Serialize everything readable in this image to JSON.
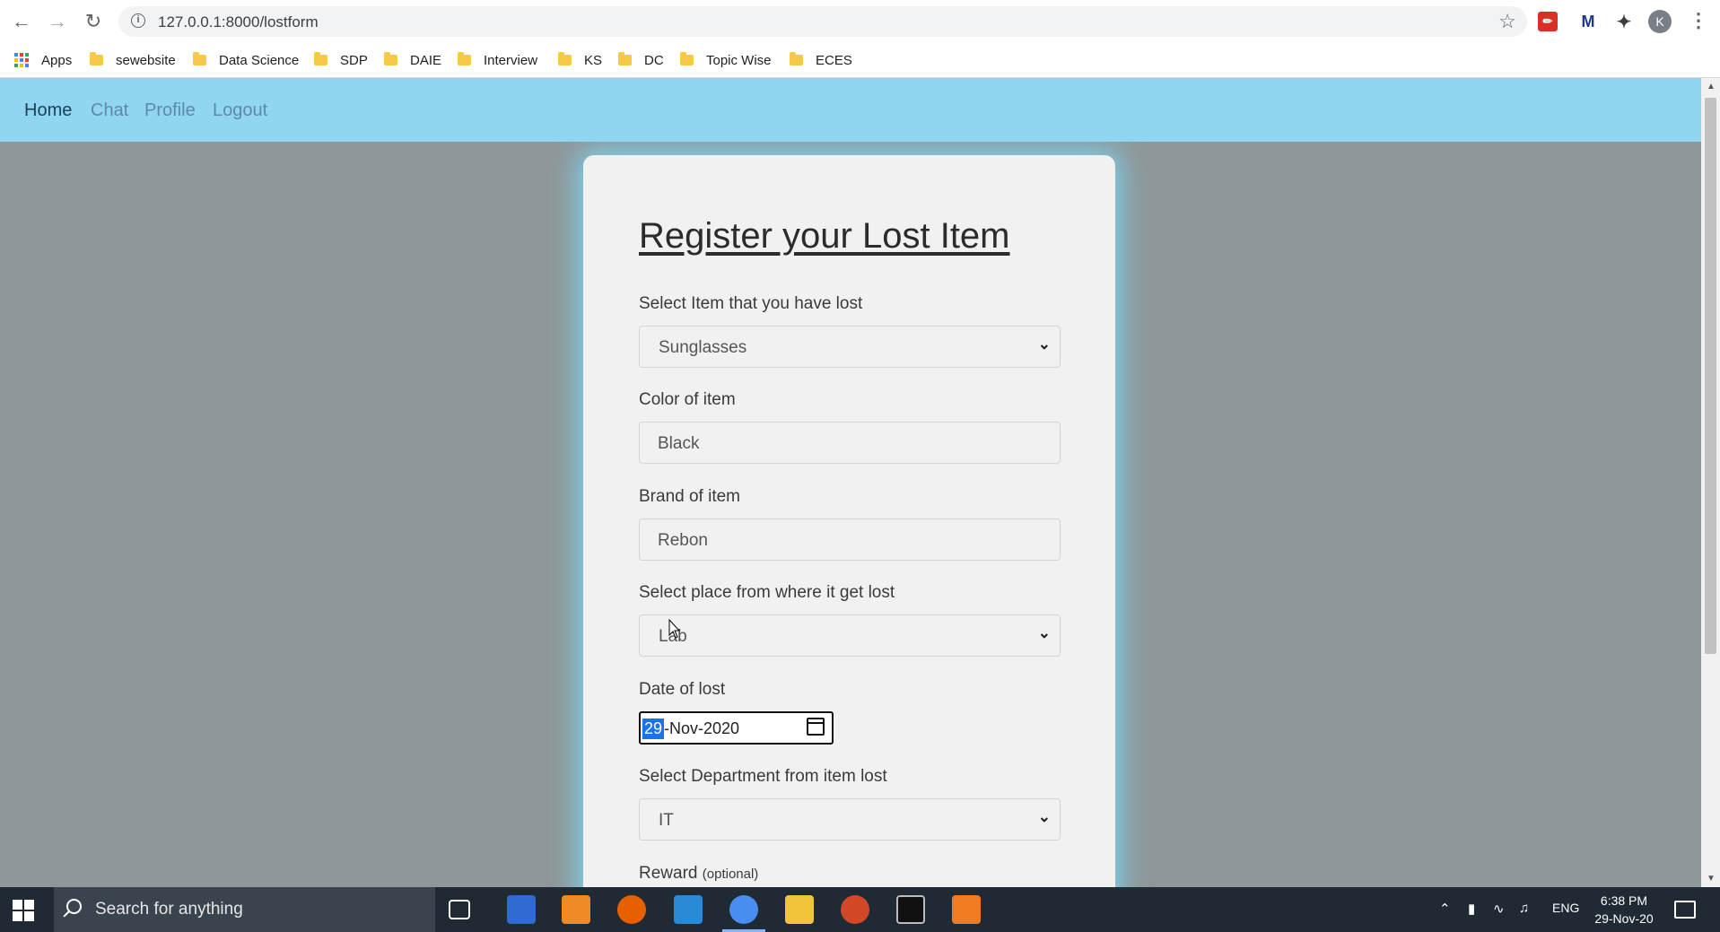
{
  "browser": {
    "url": "127.0.0.1:8000/lostform",
    "profile_initial": "K",
    "bookmarks": [
      "Apps",
      "sewebsite",
      "Data Science",
      "SDP",
      "DAIE",
      "Interview",
      "KS",
      "DC",
      "Topic Wise",
      "ECES"
    ]
  },
  "nav": {
    "items": [
      "Home",
      "Chat",
      "Profile",
      "Logout"
    ],
    "active": "Home"
  },
  "form": {
    "title": "Register your Lost Item",
    "item_label": "Select Item that you have lost",
    "item_value": "Sunglasses",
    "color_label": "Color of item",
    "color_value": "Black",
    "brand_label": "Brand of item",
    "brand_value": "Rebon",
    "place_label": "Select place from where it get lost",
    "place_value": "Lab",
    "date_label": "Date of lost",
    "date_day": "29",
    "date_rest": "-Nov-2020",
    "dept_label": "Select Department from item lost",
    "dept_value": "IT",
    "reward_label": "Reward",
    "reward_note": "(optional)"
  },
  "taskbar": {
    "search_placeholder": "Search for anything",
    "lang": "ENG",
    "time": "6:38 PM",
    "date": "29-Nov-20"
  },
  "colors": {
    "navbar": "#90d6f1",
    "page_bg": "#8e9799",
    "card_glow": "#7ed3ee",
    "taskbar": "#1f2a35"
  }
}
